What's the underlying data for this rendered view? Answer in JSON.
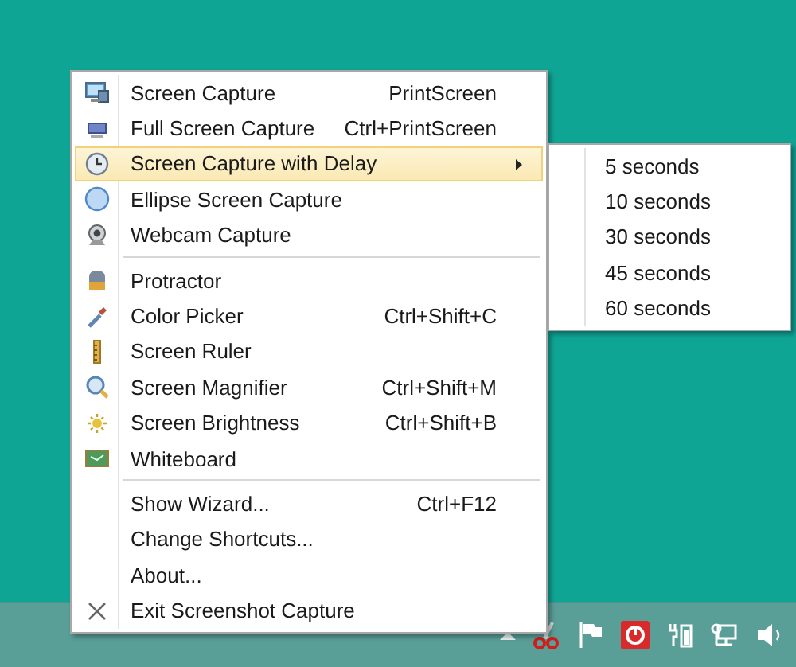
{
  "menu": {
    "items": [
      {
        "kind": "item",
        "label": "Screen Capture",
        "shortcut": "PrintScreen",
        "selected": false,
        "has_submenu": false
      },
      {
        "kind": "item",
        "label": "Full Screen Capture",
        "shortcut": "Ctrl+PrintScreen",
        "selected": false,
        "has_submenu": false
      },
      {
        "kind": "item",
        "label": "Screen Capture with Delay",
        "selected": true,
        "has_submenu": true
      },
      {
        "kind": "item",
        "label": "Ellipse Screen Capture",
        "selected": false,
        "has_submenu": false
      },
      {
        "kind": "item",
        "label": "Webcam Capture",
        "selected": false,
        "has_submenu": false
      },
      {
        "kind": "separator"
      },
      {
        "kind": "item",
        "label": "Protractor",
        "selected": false,
        "has_submenu": false
      },
      {
        "kind": "item",
        "label": "Color Picker",
        "shortcut": "Ctrl+Shift+C",
        "selected": false,
        "has_submenu": false
      },
      {
        "kind": "item",
        "label": "Screen Ruler",
        "selected": false,
        "has_submenu": false
      },
      {
        "kind": "item",
        "label": "Screen Magnifier",
        "shortcut": "Ctrl+Shift+M",
        "selected": false,
        "has_submenu": false
      },
      {
        "kind": "item",
        "label": "Screen Brightness",
        "shortcut": "Ctrl+Shift+B",
        "selected": false,
        "has_submenu": false
      },
      {
        "kind": "item",
        "label": "Whiteboard",
        "selected": false,
        "has_submenu": false
      },
      {
        "kind": "separator"
      },
      {
        "kind": "item",
        "label": "Show Wizard...",
        "shortcut": "Ctrl+F12",
        "selected": false,
        "has_submenu": false
      },
      {
        "kind": "item",
        "label": "Change Shortcuts...",
        "selected": false,
        "has_submenu": false
      },
      {
        "kind": "item",
        "label": "About...",
        "selected": false,
        "has_submenu": false
      },
      {
        "kind": "item",
        "label": "Exit Screenshot Capture",
        "selected": false,
        "has_submenu": false
      }
    ]
  },
  "submenu": {
    "items": [
      {
        "label": "5 seconds",
        "selected": false
      },
      {
        "label": "10 seconds",
        "selected": false
      },
      {
        "label": "30 seconds",
        "selected": false
      },
      {
        "label": "45 seconds",
        "selected": false
      },
      {
        "label": "60 seconds",
        "selected": false
      }
    ]
  }
}
